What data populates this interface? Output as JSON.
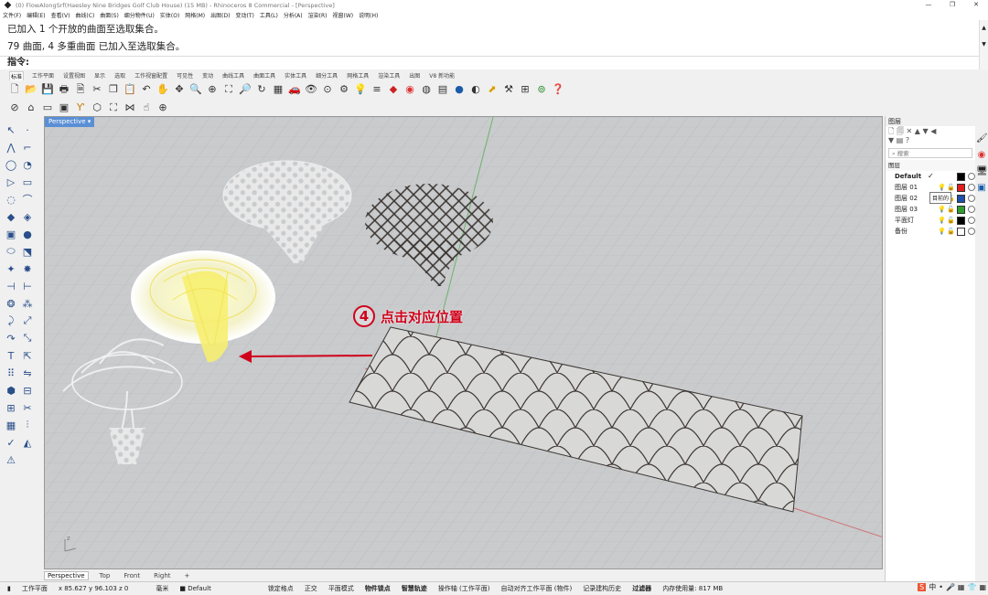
{
  "window": {
    "title": "(0) FlowAlongSrf(Haesley Nine Bridges Golf Club House) (15 MB) - Rhinoceros 8 Commercial - [Perspective]",
    "controls": [
      "—",
      "❐",
      "✕"
    ]
  },
  "menu": [
    "文件(F)",
    "编辑(E)",
    "查看(V)",
    "曲线(C)",
    "曲面(S)",
    "细分物件(U)",
    "实体(O)",
    "网格(M)",
    "出图(D)",
    "变动(T)",
    "工具(L)",
    "分析(A)",
    "渲染(R)",
    "视窗(W)",
    "说明(H)"
  ],
  "command": {
    "history": [
      "已加入 1 个开放的曲面至选取集合。",
      "79 曲面, 4 多重曲面 已加入至选取集合。"
    ],
    "prompt": "指令:",
    "scroll": [
      "▲",
      "▼"
    ]
  },
  "tabs": {
    "active": "标准",
    "items": [
      "工作平面",
      "设置视图",
      "显示",
      "选取",
      "工作视窗配置",
      "可见性",
      "变动",
      "曲线工具",
      "曲面工具",
      "实体工具",
      "细分工具",
      "网格工具",
      "渲染工具",
      "出图",
      "V8 新功能"
    ]
  },
  "viewport": {
    "name": "Perspective",
    "dropdown": "▾",
    "axis_label": "z"
  },
  "annotation": {
    "number": "4",
    "text": "点击对应位置"
  },
  "bottom_tabs": {
    "active": "Perspective",
    "items": [
      "Top",
      "Front",
      "Right",
      "+"
    ]
  },
  "status": {
    "cplane": "工作平面",
    "coords": "x 85.627  y 96.103  z 0",
    "units": "毫米",
    "layer": "Default",
    "toggles": [
      {
        "label": "锁定格点",
        "on": false
      },
      {
        "label": "正交",
        "on": false
      },
      {
        "label": "平面模式",
        "on": false
      },
      {
        "label": "物件锁点",
        "on": true
      },
      {
        "label": "智慧轨迹",
        "on": true
      },
      {
        "label": "操作轴 (工作平面)",
        "on": false
      },
      {
        "label": "自动对齐工作平面 (物件)",
        "on": false
      },
      {
        "label": "记录建构历史",
        "on": false
      },
      {
        "label": "过滤器",
        "on": true
      }
    ],
    "memory": "内存使用量: 817 MB"
  },
  "layers_panel": {
    "title": "图层",
    "search": "搜索",
    "header": "图层",
    "tooltip": "目前的",
    "rows": [
      {
        "name": "Default",
        "color": "#000000",
        "current": true
      },
      {
        "name": "图层 01",
        "color": "#e0201f"
      },
      {
        "name": "图层 02",
        "color": "#1f4fa8"
      },
      {
        "name": "图层 03",
        "color": "#2f9e2f"
      },
      {
        "name": "平面灯",
        "color": "#000000"
      },
      {
        "name": "备份",
        "color": "#ffffff"
      }
    ]
  },
  "tray": [
    "中",
    "•",
    "🎤",
    "▦",
    "👕",
    "▦"
  ]
}
